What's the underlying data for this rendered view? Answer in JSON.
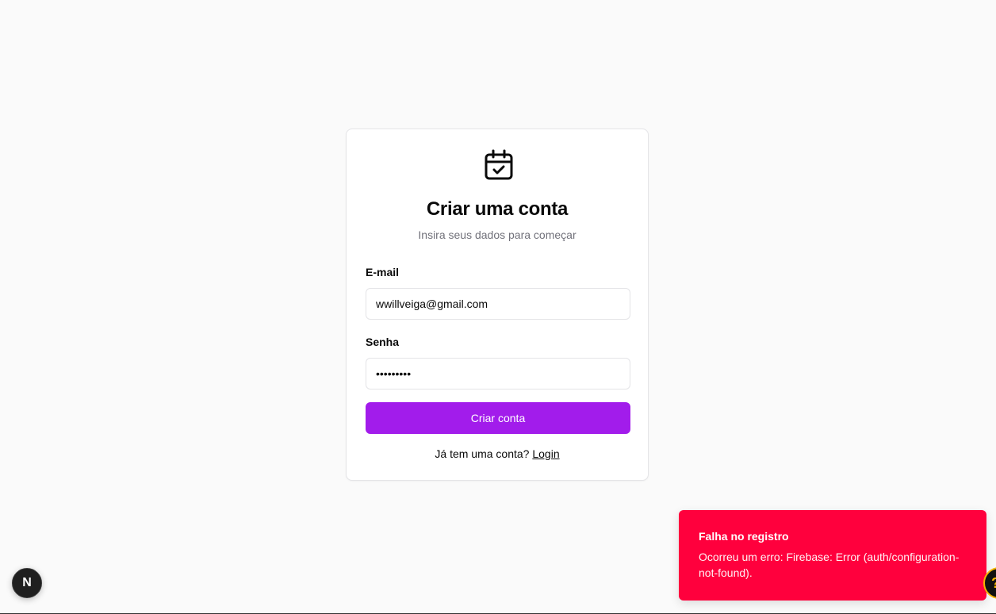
{
  "card": {
    "logo_icon": "calendar-check-icon",
    "title": "Criar uma conta",
    "subtitle": "Insira seus dados para começar"
  },
  "form": {
    "email_label": "E-mail",
    "email_value": "wwillveiga@gmail.com",
    "password_label": "Senha",
    "password_value": "123456789",
    "submit_label": "Criar conta"
  },
  "footer": {
    "prompt": "Já tem uma conta?",
    "login_link": "Login"
  },
  "toast": {
    "title": "Falha no registro",
    "message": "Ocorreu um erro: Firebase: Error (auth/configuration-not-found)."
  },
  "nextjs_badge": {
    "letter": "N",
    "icon": "nextjs-logo-icon"
  },
  "help": {
    "glyph": "?",
    "icon": "help-icon"
  },
  "colors": {
    "background": "#fafafa",
    "primary": "#a21ceb",
    "toast_error": "#ff003d",
    "muted_text": "#71717a",
    "border": "#e4e4e7"
  }
}
